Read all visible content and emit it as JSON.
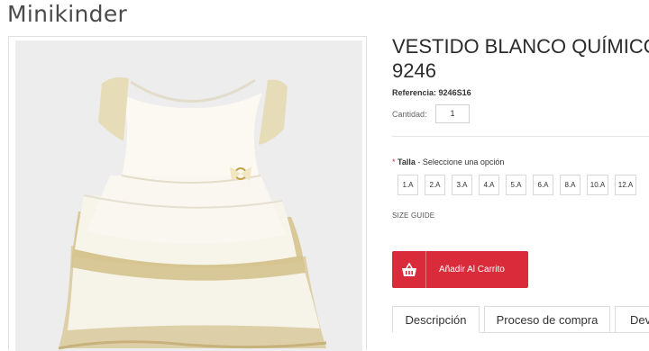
{
  "brand": "Minikinder",
  "product": {
    "title_line1": "VESTIDO BLANCO QUÍMICO",
    "title_line2": "9246",
    "reference_label": "Referencia:",
    "reference_value": "9246S16",
    "quantity_label": "Cantidad:",
    "quantity_value": "1",
    "size_required_mark": "*",
    "size_label": "Talla",
    "size_hint": " - Seleccione una opción",
    "sizes": [
      "1.A",
      "2.A",
      "3.A",
      "4.A",
      "5.A",
      "6.A",
      "8.A",
      "10.A",
      "12.A"
    ],
    "size_guide": "SIZE GUIDE",
    "add_to_cart": "Añadir Al Carrito"
  },
  "tabs": [
    "Descripción",
    "Proceso de compra",
    "Dev"
  ],
  "colors": {
    "accent_red": "#d92b3a",
    "image_bg": "#ededed"
  },
  "icons": {
    "cart": "shopping-basket-icon"
  },
  "image": {
    "subject": "white layered baby dress with gold tulle trim"
  }
}
